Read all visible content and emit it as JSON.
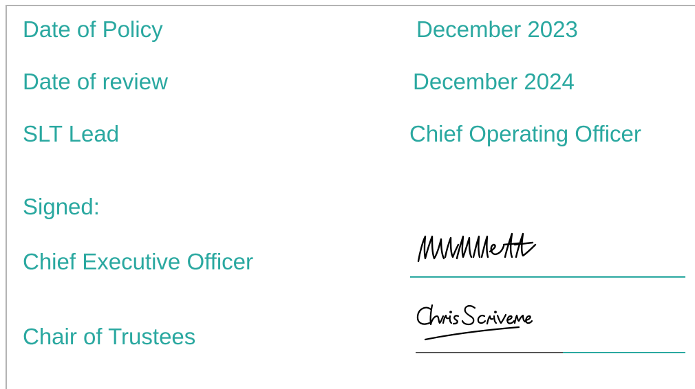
{
  "policy": {
    "date_of_policy": {
      "label": "Date of Policy",
      "value": "December 2023"
    },
    "date_of_review": {
      "label": "Date of review",
      "value": "December 2024"
    },
    "slt_lead": {
      "label": "SLT Lead",
      "value": "Chief Operating Officer"
    }
  },
  "signatures": {
    "heading": "Signed:",
    "ceo": {
      "label": "Chief Executive Officer",
      "signature_text": "MkMillett"
    },
    "chair": {
      "label": "Chair of Trustees",
      "signature_text": "Chris Scrivener"
    }
  },
  "colors": {
    "text": "#2aa8a0",
    "signature_ink": "#000000",
    "frame": "#b3b3b3"
  }
}
